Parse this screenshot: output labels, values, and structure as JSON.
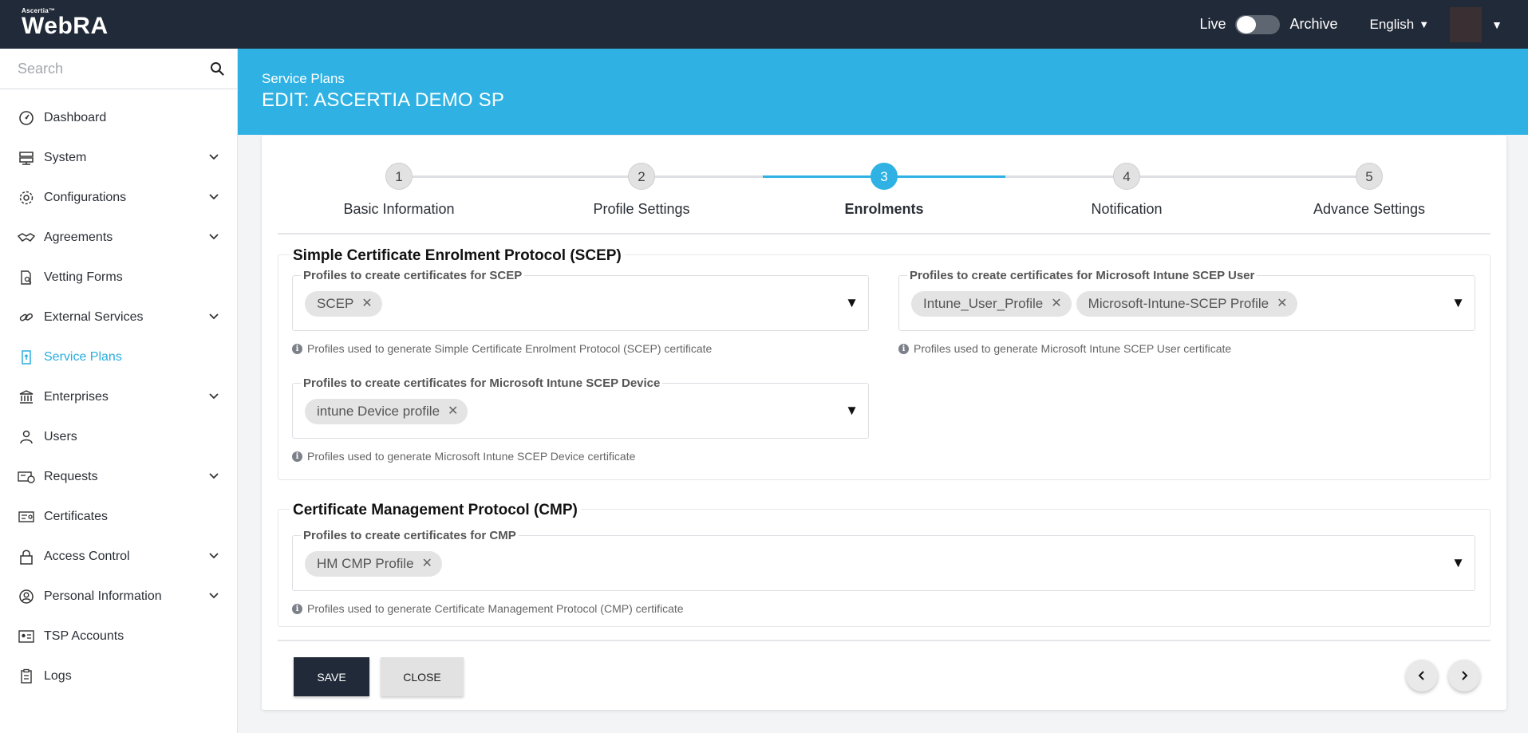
{
  "app": {
    "brand_small": "Ascertia™",
    "brand_name": "WebRA"
  },
  "topbar": {
    "live_label": "Live",
    "archive_label": "Archive",
    "language": "English"
  },
  "sidebar": {
    "search_placeholder": "Search",
    "items": [
      {
        "label": "Dashboard"
      },
      {
        "label": "System"
      },
      {
        "label": "Configurations"
      },
      {
        "label": "Agreements"
      },
      {
        "label": "Vetting Forms"
      },
      {
        "label": "External Services"
      },
      {
        "label": "Service Plans"
      },
      {
        "label": "Enterprises"
      },
      {
        "label": "Users"
      },
      {
        "label": "Requests"
      },
      {
        "label": "Certificates"
      },
      {
        "label": "Access Control"
      },
      {
        "label": "Personal Information"
      },
      {
        "label": "TSP Accounts"
      },
      {
        "label": "Logs"
      }
    ],
    "active_color": "#29aee0"
  },
  "header": {
    "breadcrumb": "Service Plans",
    "title": "EDIT: ASCERTIA DEMO SP"
  },
  "stepper": {
    "active_step": 3,
    "steps": [
      {
        "num": "1",
        "label": "Basic Information"
      },
      {
        "num": "2",
        "label": "Profile Settings"
      },
      {
        "num": "3",
        "label": "Enrolments"
      },
      {
        "num": "4",
        "label": "Notification"
      },
      {
        "num": "5",
        "label": "Advance Settings"
      }
    ]
  },
  "scep": {
    "title": "Simple Certificate Enrolment Protocol (SCEP)",
    "scep_field": {
      "label": "Profiles to create certificates for SCEP",
      "chips": [
        "SCEP"
      ],
      "hint": "Profiles used to generate Simple Certificate Enrolment Protocol (SCEP) certificate"
    },
    "intune_user_field": {
      "label": "Profiles to create certificates for Microsoft Intune SCEP User",
      "chips": [
        "Intune_User_Profile",
        "Microsoft-Intune-SCEP Profile"
      ],
      "hint": "Profiles used to generate Microsoft Intune SCEP User certificate"
    },
    "intune_device_field": {
      "label": "Profiles to create certificates for Microsoft Intune SCEP Device",
      "chips": [
        "intune Device profile"
      ],
      "hint": "Profiles used to generate Microsoft Intune SCEP Device certificate"
    }
  },
  "cmp": {
    "title": "Certificate Management Protocol (CMP)",
    "cmp_field": {
      "label": "Profiles to create certificates for CMP",
      "chips": [
        "HM CMP Profile"
      ],
      "hint": "Profiles used to generate Certificate Management Protocol (CMP) certificate"
    }
  },
  "footer": {
    "save_label": "SAVE",
    "close_label": "CLOSE"
  },
  "colors": {
    "topbar": "#212a38",
    "accent": "#2fb2e3"
  },
  "icons": {
    "caret": "▼",
    "chip_remove": "✕",
    "info": "i"
  }
}
